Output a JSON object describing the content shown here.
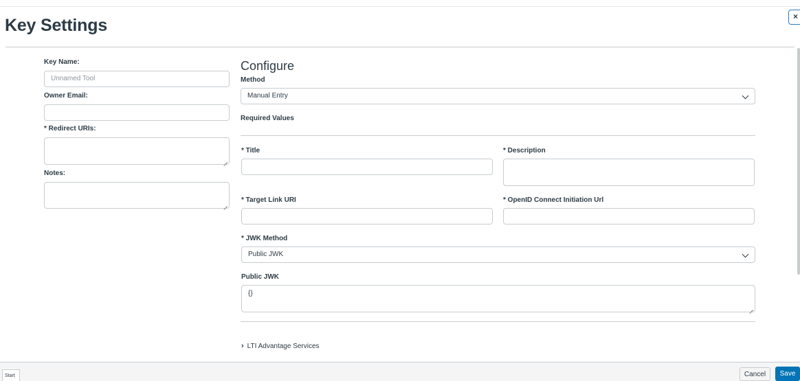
{
  "header": {
    "title": "Key Settings",
    "close_label": "×"
  },
  "left": {
    "key_name_label": "Key Name:",
    "key_name_placeholder": "Unnamed Tool",
    "owner_email_label": "Owner Email:",
    "redirect_uris_label": "* Redirect URIs:",
    "notes_label": "Notes:"
  },
  "configure": {
    "heading": "Configure",
    "method_label": "Method",
    "method_value": "Manual Entry",
    "required_values_label": "Required Values",
    "title_label": "* Title",
    "description_label": "* Description",
    "target_link_label": "* Target Link URI",
    "openid_label": "* OpenID Connect Initiation Url",
    "jwk_method_label": "* JWK Method",
    "jwk_method_value": "Public JWK",
    "public_jwk_label": "Public JWK",
    "public_jwk_value": "{}",
    "lti_services_label": "LTI Advantage Services"
  },
  "footer": {
    "start_label": "Start",
    "cancel_label": "Cancel",
    "save_label": "Save"
  },
  "colors": {
    "primary": "#0374b5",
    "text": "#2d3b45",
    "border": "#c7cdd1"
  }
}
